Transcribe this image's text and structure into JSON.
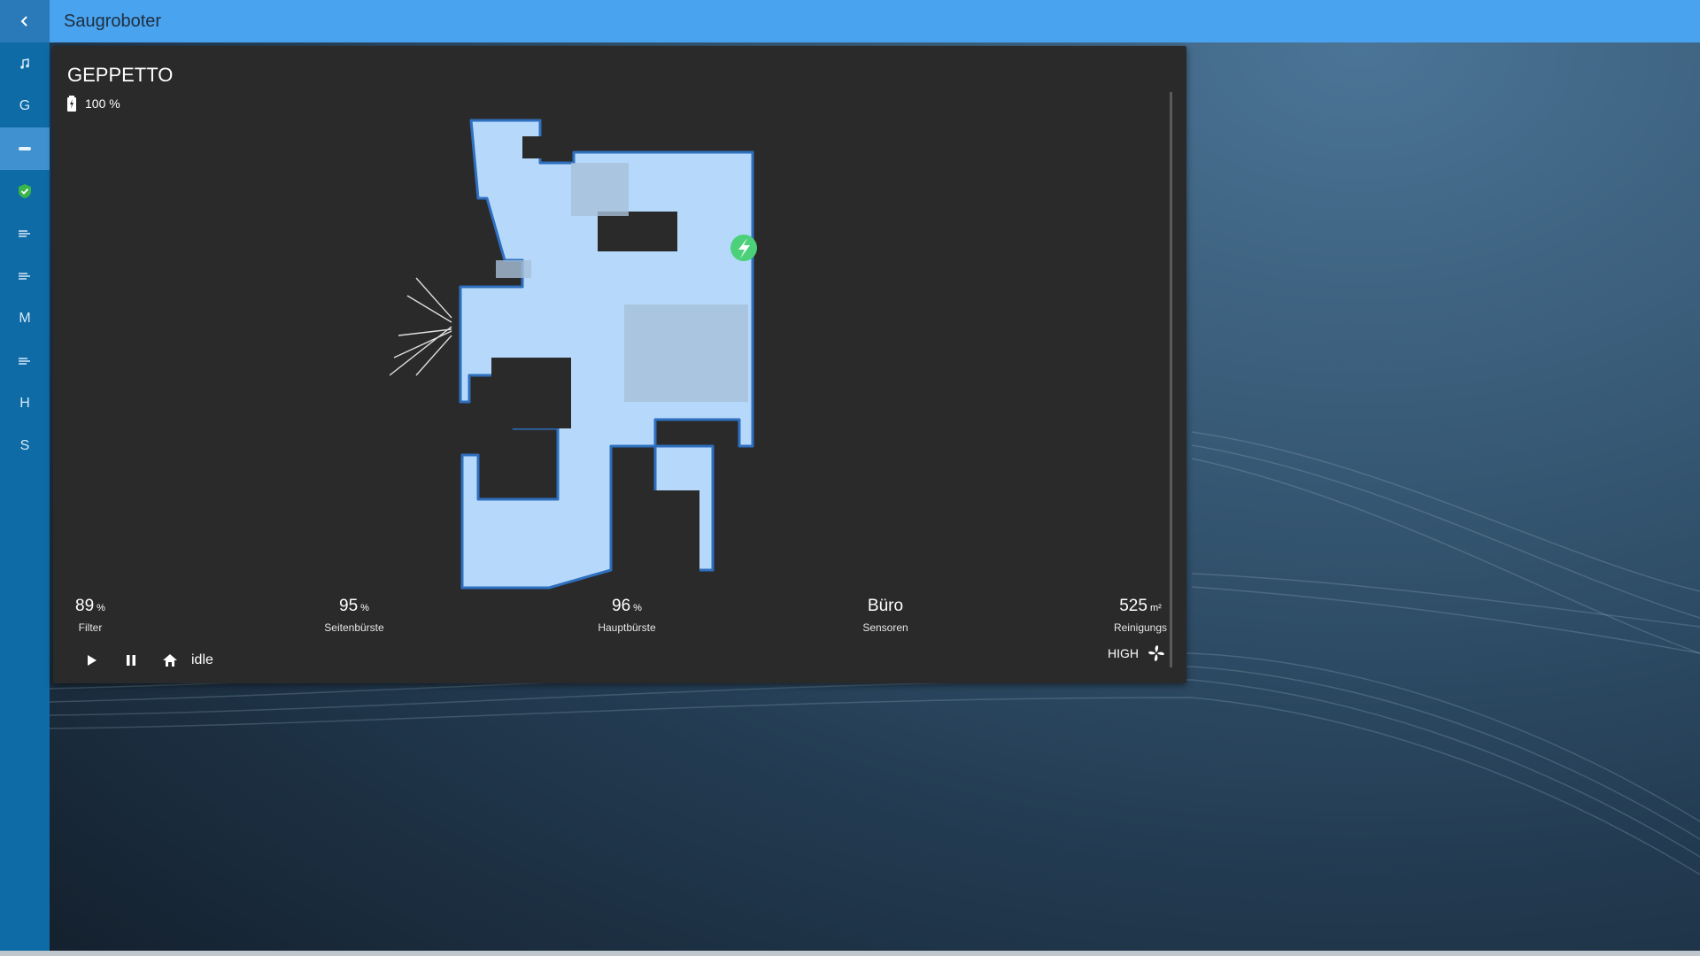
{
  "header": {
    "title": "Saugroboter"
  },
  "sidebar": {
    "items": [
      {
        "label": "",
        "icon": "music-icon"
      },
      {
        "label": "G",
        "icon": ""
      },
      {
        "label": "",
        "icon": "vacuum-icon",
        "active": true
      },
      {
        "label": "",
        "icon": "shield-check-icon"
      },
      {
        "label": "",
        "icon": "fan-speed-icon"
      },
      {
        "label": "",
        "icon": "fan-speed-icon"
      },
      {
        "label": "M",
        "icon": ""
      },
      {
        "label": "",
        "icon": "fan-speed-icon"
      },
      {
        "label": "H",
        "icon": ""
      },
      {
        "label": "S",
        "icon": ""
      }
    ]
  },
  "card": {
    "name": "GEPPETTO",
    "battery": "100 %",
    "stats": {
      "filter": {
        "value": "89",
        "unit": "%",
        "label": "Filter"
      },
      "side_brush": {
        "value": "95",
        "unit": "%",
        "label": "Seitenbürste"
      },
      "main_brush": {
        "value": "96",
        "unit": "%",
        "label": "Hauptbürste"
      },
      "sensors": {
        "value": "Büro",
        "unit": "",
        "label": "Sensoren"
      },
      "cleaning": {
        "value": "525",
        "unit": "m²",
        "label": "Reinigungs"
      }
    },
    "state": "idle",
    "fan_speed": "HIGH"
  },
  "colors": {
    "topbar": "#4aa3ef",
    "sidebar": "#0f6ba6",
    "card": "#2a2a2a",
    "map_floor": "#b6d9fb",
    "map_wall": "#2f6fbf",
    "dock": "#4cd17a"
  }
}
